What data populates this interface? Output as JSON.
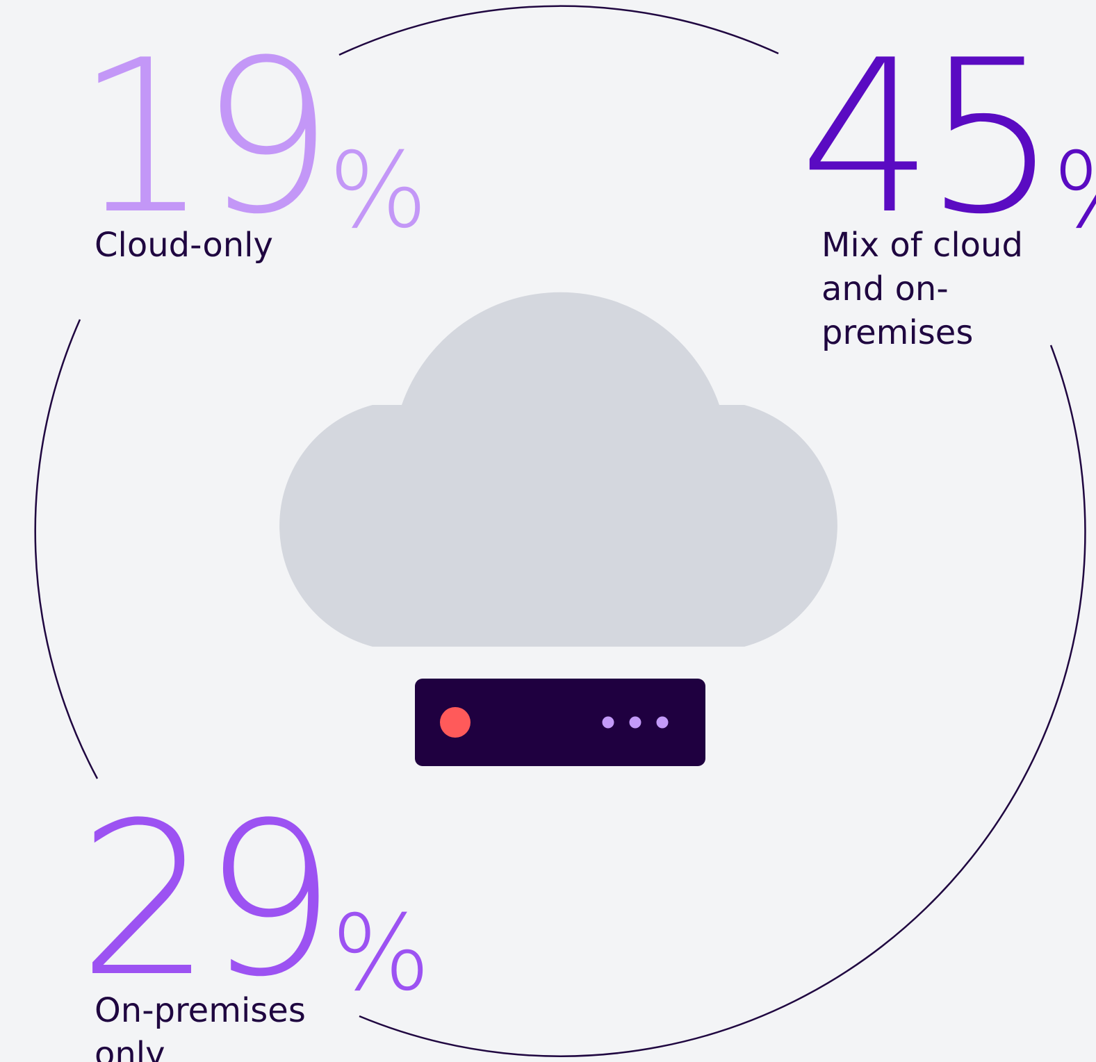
{
  "stats": {
    "cloud_only": {
      "value": "19",
      "unit": "%",
      "label": "Cloud-only",
      "color": "#c397f7"
    },
    "mix": {
      "value": "45",
      "unit": "%",
      "label": "Mix of cloud\nand on-premises",
      "color": "#5a0bc2"
    },
    "on_premises": {
      "value": "29",
      "unit": "%",
      "label": "On-premises\nonly",
      "color": "#9c52f2"
    }
  },
  "colors": {
    "background": "#f3f4f6",
    "ring": "#1f0640",
    "cloud": "#d4d7de",
    "server": "#1f0040",
    "server_led": "#ff5a5a",
    "server_dots": "#c39af8",
    "text": "#1f0640"
  },
  "icons": {
    "cloud": "cloud-icon",
    "server": "server-icon"
  }
}
